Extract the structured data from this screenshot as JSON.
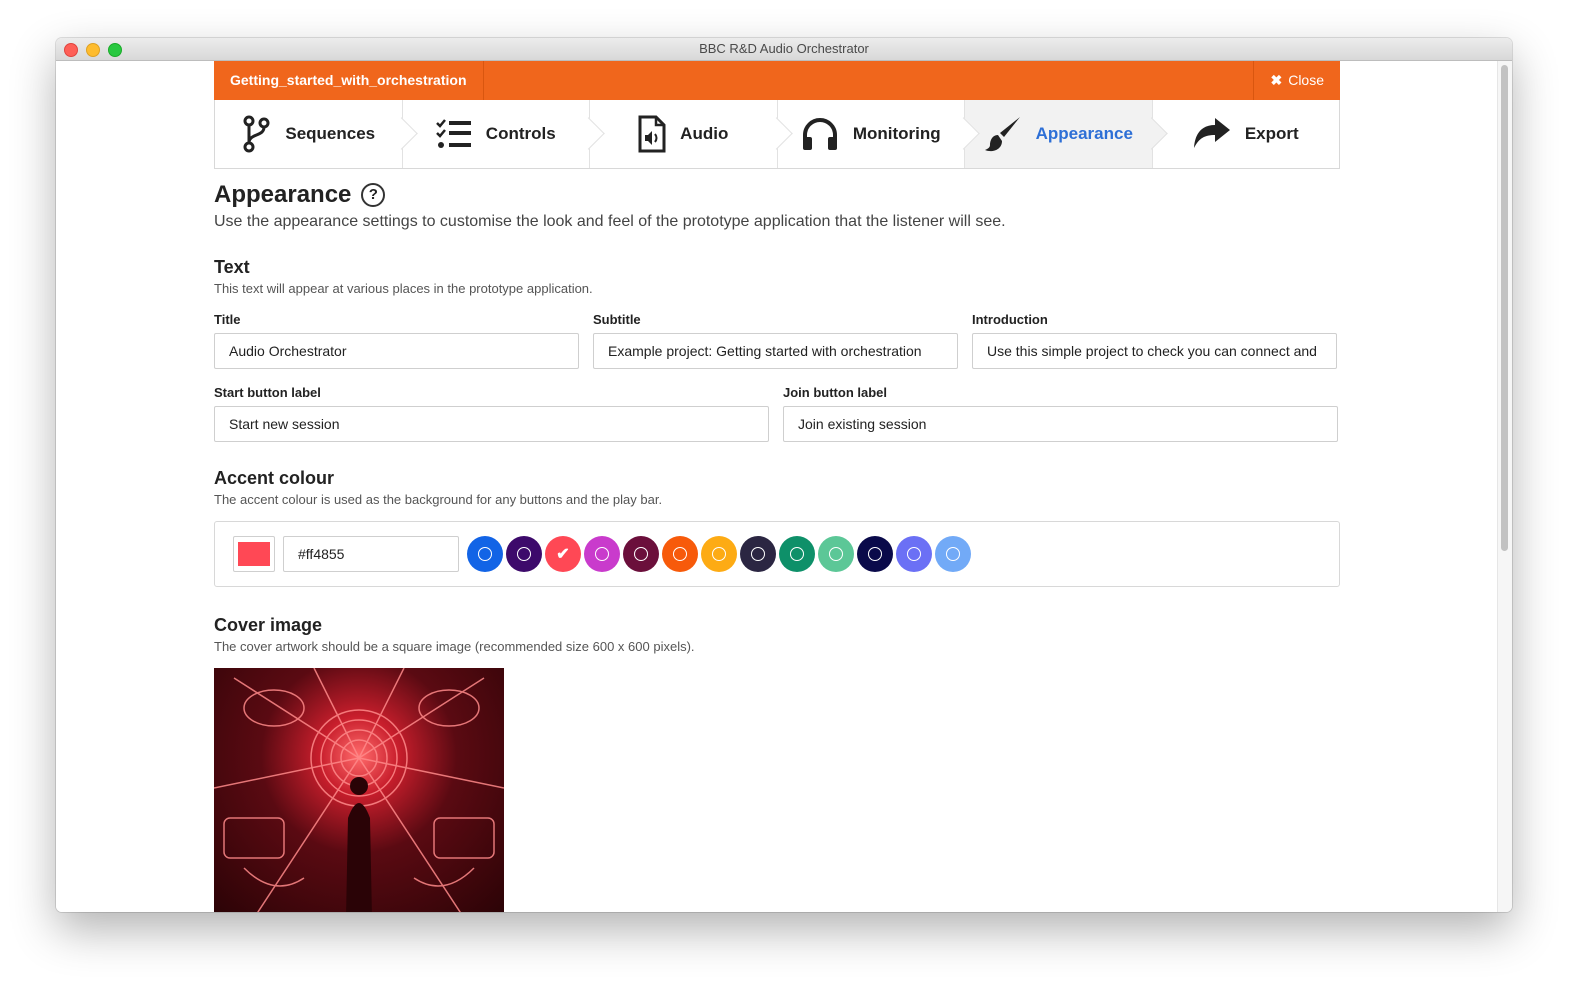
{
  "window": {
    "title": "BBC R&D Audio Orchestrator"
  },
  "topbar": {
    "project_name": "Getting_started_with_orchestration",
    "close_label": "Close"
  },
  "steps": [
    {
      "label": "Sequences",
      "icon": "branch-icon"
    },
    {
      "label": "Controls",
      "icon": "checklist-icon"
    },
    {
      "label": "Audio",
      "icon": "audio-file-icon"
    },
    {
      "label": "Monitoring",
      "icon": "headphones-icon"
    },
    {
      "label": "Appearance",
      "icon": "paintbrush-icon",
      "active": true
    },
    {
      "label": "Export",
      "icon": "share-arrow-icon"
    }
  ],
  "page": {
    "heading": "Appearance",
    "help_glyph": "?",
    "lead": "Use the appearance settings to customise the look and feel of the prototype application that the listener will see."
  },
  "text_section": {
    "heading": "Text",
    "desc": "This text will appear at various places in the prototype application.",
    "title_label": "Title",
    "title_value": "Audio Orchestrator",
    "subtitle_label": "Subtitle",
    "subtitle_value": "Example project: Getting started with orchestration",
    "intro_label": "Introduction",
    "intro_value": "Use this simple project to check you can connect and",
    "start_label": "Start button label",
    "start_value": "Start new session",
    "join_label": "Join button label",
    "join_value": "Join existing session"
  },
  "accent_section": {
    "heading": "Accent colour",
    "desc": "The accent colour is used as the background for any buttons and the play bar.",
    "hex_value": "#ff4855",
    "selected_colour": "#ff4855",
    "swatches": [
      "#1264e6",
      "#3d0a6b",
      "#ff4855",
      "#c93bcc",
      "#6b0f3b",
      "#f75a0a",
      "#fdab14",
      "#2b2642",
      "#0e9069",
      "#5cc797",
      "#0a0a4a",
      "#6b70f5",
      "#72aaf7"
    ]
  },
  "cover_section": {
    "heading": "Cover image",
    "desc": "The cover artwork should be a square image (recommended size 600 x 600 pixels)."
  },
  "colors": {
    "brand": "#f0661c",
    "active_tab": "#2d6fd6"
  }
}
